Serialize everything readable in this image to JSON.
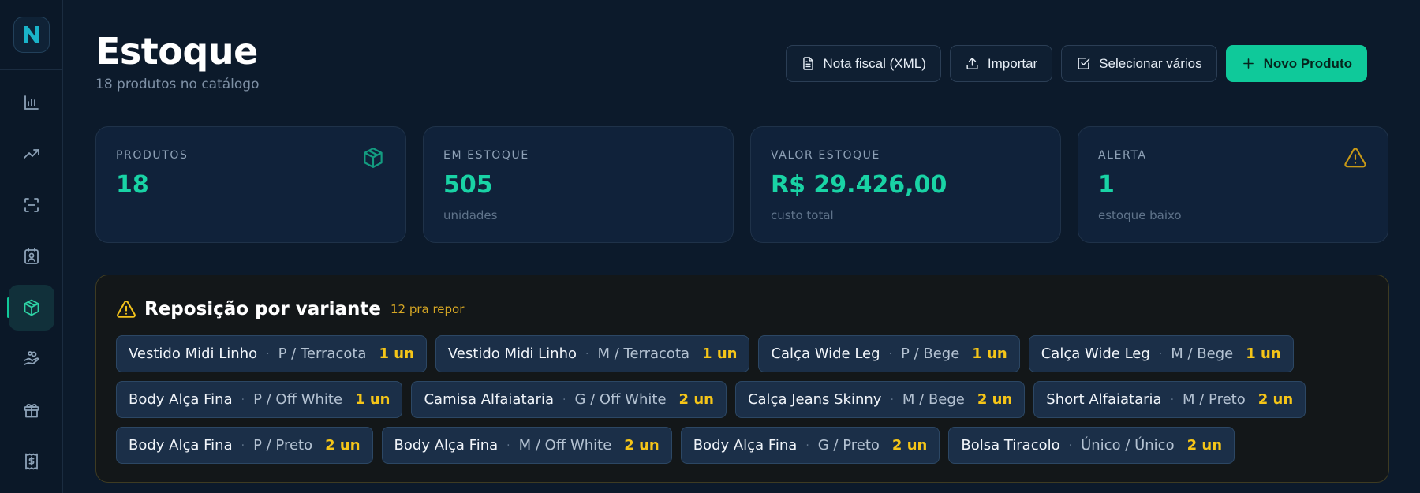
{
  "brand": {
    "logo_letter": "N",
    "accent": "#10c99a"
  },
  "sidebar": {
    "items": [
      {
        "name": "bar-chart-icon"
      },
      {
        "name": "trending-up-icon"
      },
      {
        "name": "scan-icon"
      },
      {
        "name": "contact-card-icon"
      },
      {
        "name": "package-icon",
        "active": true
      },
      {
        "name": "hand-coins-icon"
      },
      {
        "name": "gift-icon"
      },
      {
        "name": "receipt-icon"
      }
    ]
  },
  "header": {
    "title": "Estoque",
    "subtitle": "18 produtos no catálogo"
  },
  "toolbar": {
    "invoice_label": "Nota fiscal (XML)",
    "import_label": "Importar",
    "select_label": "Selecionar vários",
    "new_label": "Novo Produto"
  },
  "stats": [
    {
      "label": "PRODUTOS",
      "value": "18",
      "sub": "",
      "icon": "package-icon"
    },
    {
      "label": "EM ESTOQUE",
      "value": "505",
      "sub": "unidades"
    },
    {
      "label": "VALOR ESTOQUE",
      "value": "R$ 29.426,00",
      "sub": "custo total"
    },
    {
      "label": "ALERTA",
      "value": "1",
      "sub": "estoque baixo",
      "icon": "warning-icon"
    }
  ],
  "restock": {
    "title": "Reposição por variante",
    "count": "12 pra repor",
    "items": [
      {
        "name": "Vestido Midi Linho",
        "variant": "P / Terracota",
        "qty": "1 un"
      },
      {
        "name": "Vestido Midi Linho",
        "variant": "M / Terracota",
        "qty": "1 un"
      },
      {
        "name": "Calça Wide Leg",
        "variant": "P / Bege",
        "qty": "1 un"
      },
      {
        "name": "Calça Wide Leg",
        "variant": "M / Bege",
        "qty": "1 un"
      },
      {
        "name": "Body Alça Fina",
        "variant": "P / Off White",
        "qty": "1 un"
      },
      {
        "name": "Camisa Alfaiataria",
        "variant": "G / Off White",
        "qty": "2 un"
      },
      {
        "name": "Calça Jeans Skinny",
        "variant": "M / Bege",
        "qty": "2 un"
      },
      {
        "name": "Short Alfaiataria",
        "variant": "M / Preto",
        "qty": "2 un"
      },
      {
        "name": "Body Alça Fina",
        "variant": "P / Preto",
        "qty": "2 un"
      },
      {
        "name": "Body Alça Fina",
        "variant": "M / Off White",
        "qty": "2 un"
      },
      {
        "name": "Body Alça Fina",
        "variant": "G / Preto",
        "qty": "2 un"
      },
      {
        "name": "Bolsa Tiracolo",
        "variant": "Único / Único",
        "qty": "2 un"
      }
    ]
  }
}
